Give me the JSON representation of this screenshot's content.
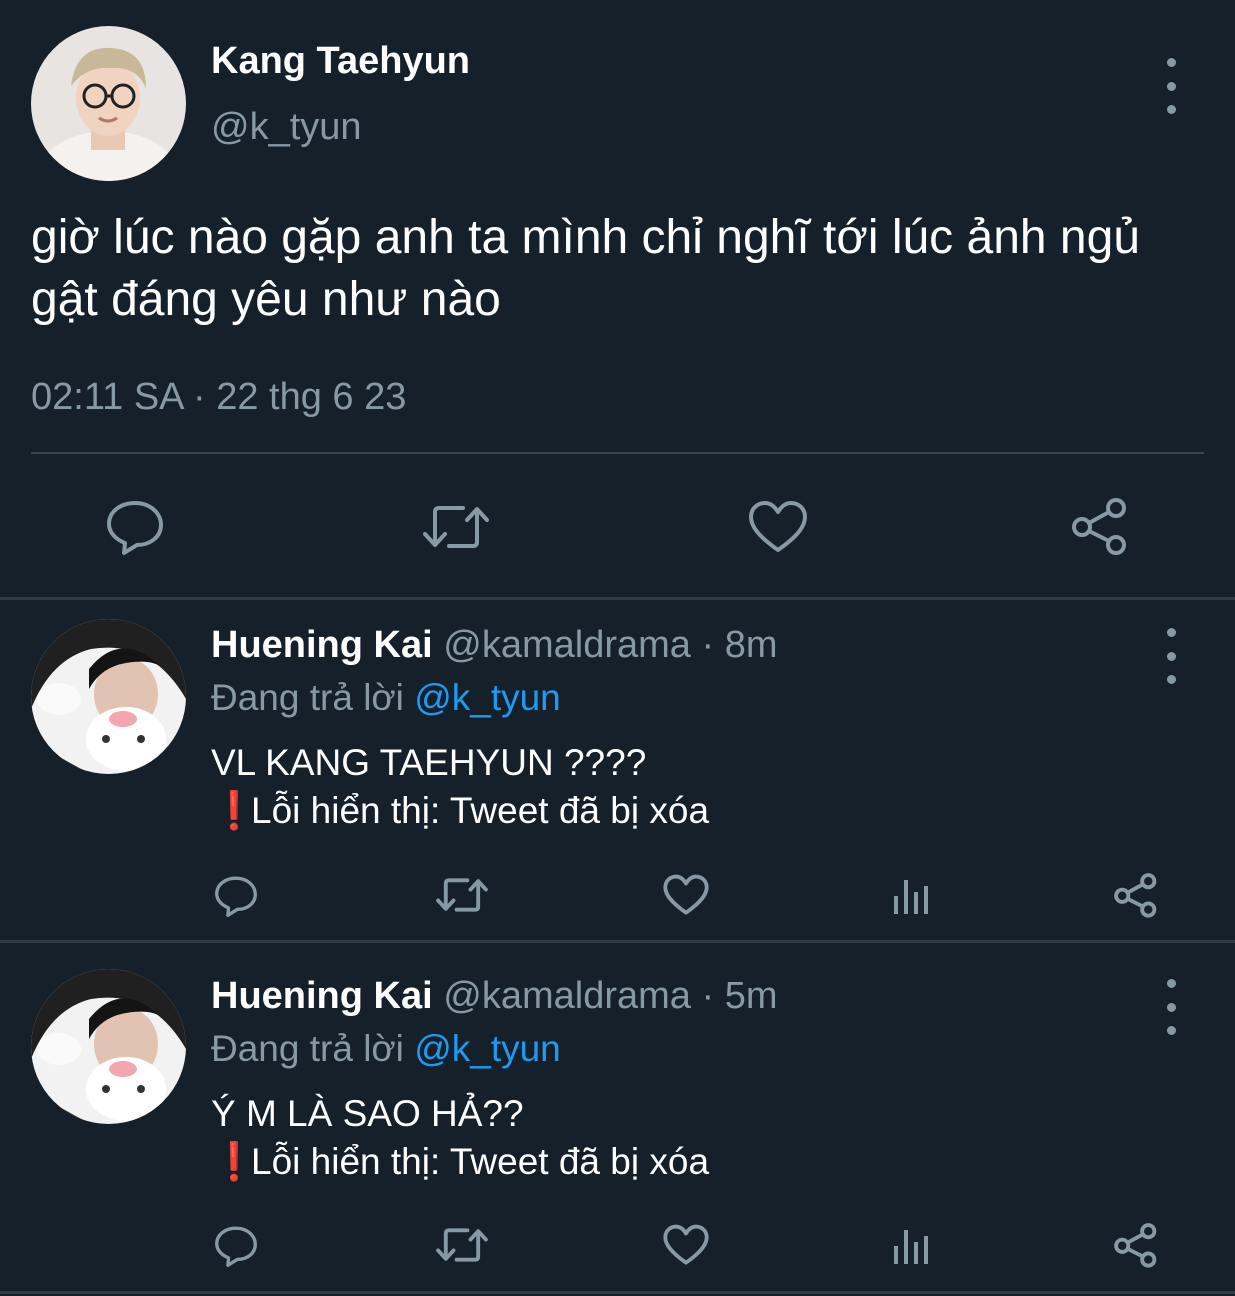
{
  "main_tweet": {
    "author_name": "Kang Taehyun",
    "author_handle": "@k_tyun",
    "text": "giờ lúc nào gặp anh ta mình chỉ nghĩ tới lúc ảnh ngủ gật đáng yêu như nào",
    "timestamp": "02:11 SA · 22 thg 6 23",
    "actions": [
      "reply-icon",
      "retweet-icon",
      "like-icon",
      "share-icon"
    ]
  },
  "replies": [
    {
      "author_name": "Huening Kai",
      "author_handle": "@kamaldrama",
      "separator": " · ",
      "time": "8m",
      "replying_to_prefix": "Đang trả lời ",
      "replying_to_handle": "@k_tyun",
      "line1": "VL KANG TAEHYUN ????",
      "error_mark": "❗",
      "line2": "Lỗi hiển thị: Tweet đã bị xóa",
      "actions": [
        "reply-icon",
        "retweet-icon",
        "like-icon",
        "analytics-icon",
        "share-icon"
      ]
    },
    {
      "author_name": "Huening Kai",
      "author_handle": "@kamaldrama",
      "separator": " · ",
      "time": "5m",
      "replying_to_prefix": "Đang trả lời ",
      "replying_to_handle": "@k_tyun",
      "line1": "Ý M LÀ SAO HẢ??",
      "error_mark": "❗",
      "line2": "Lỗi hiển thị: Tweet đã bị xóa",
      "actions": [
        "reply-icon",
        "retweet-icon",
        "like-icon",
        "analytics-icon",
        "share-icon"
      ]
    }
  ],
  "colors": {
    "background": "#15202b",
    "secondary_text": "#8899a6",
    "mention": "#1d9bf0",
    "divider": "#38444d"
  }
}
